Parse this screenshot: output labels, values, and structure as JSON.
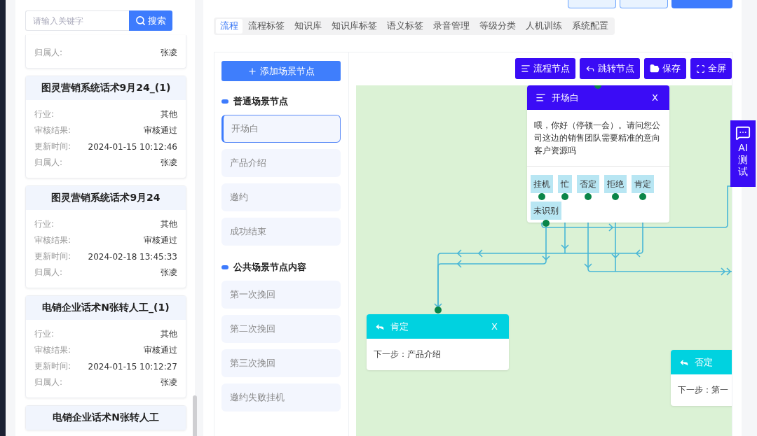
{
  "header_buttons": [
    {
      "kind": "outline"
    },
    {
      "kind": "outline"
    },
    {
      "kind": "primary"
    }
  ],
  "left_panel": {
    "search": {
      "placeholder": "请输入关键字",
      "button": "搜索"
    },
    "cards": [
      {
        "partial": true,
        "fields": [
          {
            "label": "归属人:",
            "value": "张凌"
          }
        ]
      },
      {
        "title": "图灵营销系统话术9月24_(1)",
        "fields": [
          {
            "label": "行业:",
            "value": "其他"
          },
          {
            "label": "审核结果:",
            "value": "审核通过"
          },
          {
            "label": "更新时间:",
            "value": "2024-01-15 10:12:46"
          },
          {
            "label": "归属人:",
            "value": "张凌"
          }
        ]
      },
      {
        "title": "图灵营销系统话术9月24",
        "fields": [
          {
            "label": "行业:",
            "value": "其他"
          },
          {
            "label": "审核结果:",
            "value": "审核通过"
          },
          {
            "label": "更新时间:",
            "value": "2024-02-18 13:45:33"
          },
          {
            "label": "归属人:",
            "value": "张凌"
          }
        ]
      },
      {
        "title": "电销企业话术N张转人工_(1)",
        "fields": [
          {
            "label": "行业:",
            "value": "其他"
          },
          {
            "label": "审核结果:",
            "value": "审核通过"
          },
          {
            "label": "更新时间:",
            "value": "2024-01-15 10:12:27"
          },
          {
            "label": "归属人:",
            "value": "张凌"
          }
        ]
      },
      {
        "title": "电销企业话术N张转人工"
      }
    ]
  },
  "tabs": [
    {
      "label": "流程",
      "selected": true
    },
    {
      "label": "流程标签",
      "selected": false
    },
    {
      "label": "知识库",
      "selected": false
    },
    {
      "label": "知识库标签",
      "selected": false
    },
    {
      "label": "语义标签",
      "selected": false
    },
    {
      "label": "录音管理",
      "selected": false
    },
    {
      "label": "等级分类",
      "selected": false
    },
    {
      "label": "人机训练",
      "selected": false
    },
    {
      "label": "系统配置",
      "selected": false
    }
  ],
  "scene_sidebar": {
    "add_button": "添加场景节点",
    "sections": [
      {
        "title": "普通场景节点",
        "items": [
          {
            "label": "开场白",
            "selected": true
          },
          {
            "label": "产品介绍",
            "selected": false
          },
          {
            "label": "邀约",
            "selected": false
          },
          {
            "label": "成功结束",
            "selected": false
          }
        ]
      },
      {
        "title": "公共场景节点内容",
        "items": [
          {
            "label": "第一次挽回",
            "selected": false
          },
          {
            "label": "第二次挽回",
            "selected": false
          },
          {
            "label": "第三次挽回",
            "selected": false
          },
          {
            "label": "邀约失败挂机",
            "selected": false
          }
        ]
      }
    ]
  },
  "toolbar": [
    {
      "kind": "node",
      "label": "流程节点"
    },
    {
      "kind": "jump",
      "label": "跳转节点"
    },
    {
      "kind": "save",
      "label": "保存"
    },
    {
      "kind": "fullscreen",
      "label": "全屏"
    }
  ],
  "flow_nodes": [
    {
      "kind": "scene",
      "title": "开场白",
      "close": "X",
      "text": "喂，你好（停顿一会）。请问您公司这边的销售团队需要精准的意向客户资源吗",
      "branches": [
        "挂机",
        "忙",
        "否定",
        "拒绝",
        "肯定",
        "未识别"
      ]
    },
    {
      "kind": "jump",
      "title": "肯定",
      "close": "X",
      "text": "下一步：产品介绍"
    },
    {
      "kind": "jump",
      "title": "否定",
      "text": "下一步：第一"
    }
  ],
  "ai_test_button": "AI测试"
}
